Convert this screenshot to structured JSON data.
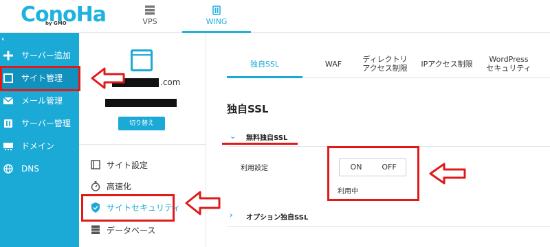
{
  "header": {
    "logo_text": "ConoHa",
    "logo_sub": "by GMO",
    "nav": [
      {
        "label": "VPS",
        "icon": "server-icon"
      },
      {
        "label": "WING",
        "icon": "wing-icon"
      }
    ]
  },
  "sidebar": {
    "collapse_label": "‹",
    "items": [
      {
        "label": "サーバー追加",
        "icon": "plus-icon"
      },
      {
        "label": "サイト管理",
        "icon": "window-icon"
      },
      {
        "label": "メール管理",
        "icon": "mail-icon"
      },
      {
        "label": "サーバー管理",
        "icon": "server-manage-icon"
      },
      {
        "label": "ドメイン",
        "icon": "domain-icon"
      },
      {
        "label": "DNS",
        "icon": "globe-icon"
      }
    ]
  },
  "site_panel": {
    "domain_suffix": ".com",
    "switch_label": "切り替え",
    "menu": [
      {
        "label": "サイト設定",
        "icon": "settings-icon"
      },
      {
        "label": "高速化",
        "icon": "stopwatch-icon"
      },
      {
        "label": "サイトセキュリティ",
        "icon": "shield-icon"
      },
      {
        "label": "データベース",
        "icon": "database-icon"
      }
    ]
  },
  "tabs": [
    {
      "label": "独自SSL"
    },
    {
      "label": "WAF"
    },
    {
      "label": "ディレクトリ\nアクセス制限"
    },
    {
      "label": "IPアクセス制限"
    },
    {
      "label": "WordPress\nセキュリティ"
    }
  ],
  "ssl": {
    "title": "独自SSL",
    "free_ssl_label": "無料独自SSL",
    "setting_label": "利用設定",
    "toggle_on": "ON",
    "toggle_off": "OFF",
    "status": "利用中",
    "option_label": "オプション独自SSL"
  },
  "colors": {
    "accent": "#1ba9d6",
    "sidebar_active": "#1191bd",
    "annotation": "#e01919"
  }
}
